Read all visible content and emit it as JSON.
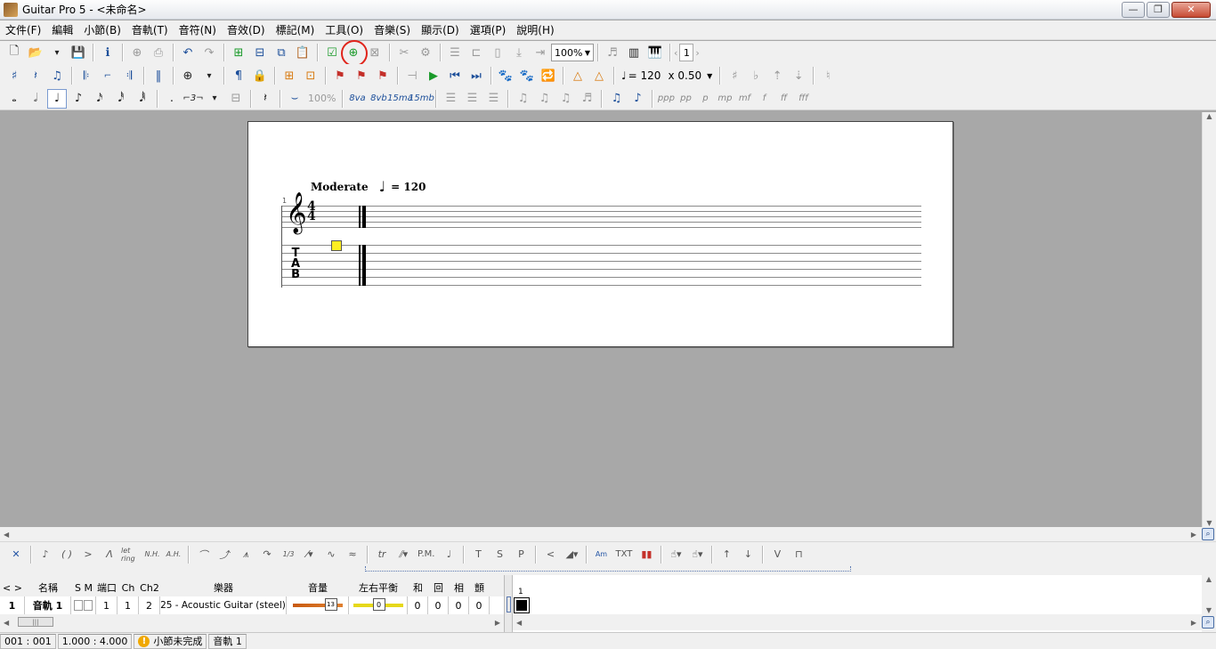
{
  "window": {
    "title": "Guitar Pro 5 - <未命名>",
    "buttons": {
      "minimize": "—",
      "maximize": "❐",
      "close": "✕"
    }
  },
  "menu": [
    "文件(F)",
    "編輯",
    "小節(B)",
    "音軌(T)",
    "音符(N)",
    "音效(D)",
    "標記(M)",
    "工具(O)",
    "音樂(S)",
    "顯示(D)",
    "選項(P)",
    "說明(H)"
  ],
  "toolbar1": {
    "zoom": "100%",
    "page": "1"
  },
  "toolbar2": {
    "tempo": "= 120",
    "speed": "x 0.50"
  },
  "toolbar3": {
    "percent": "100%",
    "ottava": [
      "8va",
      "8vb",
      "15ma",
      "15mb"
    ],
    "dynamics": [
      "ppp",
      "pp",
      "p",
      "mp",
      "mf",
      "f",
      "ff",
      "fff"
    ]
  },
  "score": {
    "tempo_text": "Moderate",
    "tempo_value": "= 120",
    "bar_number": "1",
    "time_sig_top": "4",
    "time_sig_bottom": "4",
    "tab_letters": [
      "T",
      "A",
      "B"
    ]
  },
  "effects": {
    "nh": "N.H.",
    "ah": "A.H.",
    "let_ring": "let ring",
    "pm": "P.M.",
    "t": "T",
    "s": "S",
    "p": "P",
    "txt": "TXT",
    "v": "V",
    "am": "Am",
    "slash13": "1/3"
  },
  "tracks": {
    "header": {
      "nav": "< >",
      "name": "名稱",
      "sm": "S M",
      "port": "端口",
      "ch": "Ch",
      "ch2": "Ch2",
      "instrument": "樂器",
      "volume": "音量",
      "pan": "左右平衡",
      "chorus": "和",
      "reverb": "回",
      "phaser": "相",
      "tremolo": "顫"
    },
    "rows": [
      {
        "index": "1",
        "name": "音軌 1",
        "port": "1",
        "ch": "1",
        "ch2": "2",
        "instrument": "25 - Acoustic Guitar (steel)",
        "volume": "13",
        "pan": "0",
        "chorus": "0",
        "reverb": "0",
        "phaser": "0",
        "tremolo": "0"
      }
    ],
    "measure_number": "1"
  },
  "status": {
    "position": "001 : 001",
    "beat": "1.000 : 4.000",
    "warning": "小節未完成",
    "track": "音軌 1"
  }
}
